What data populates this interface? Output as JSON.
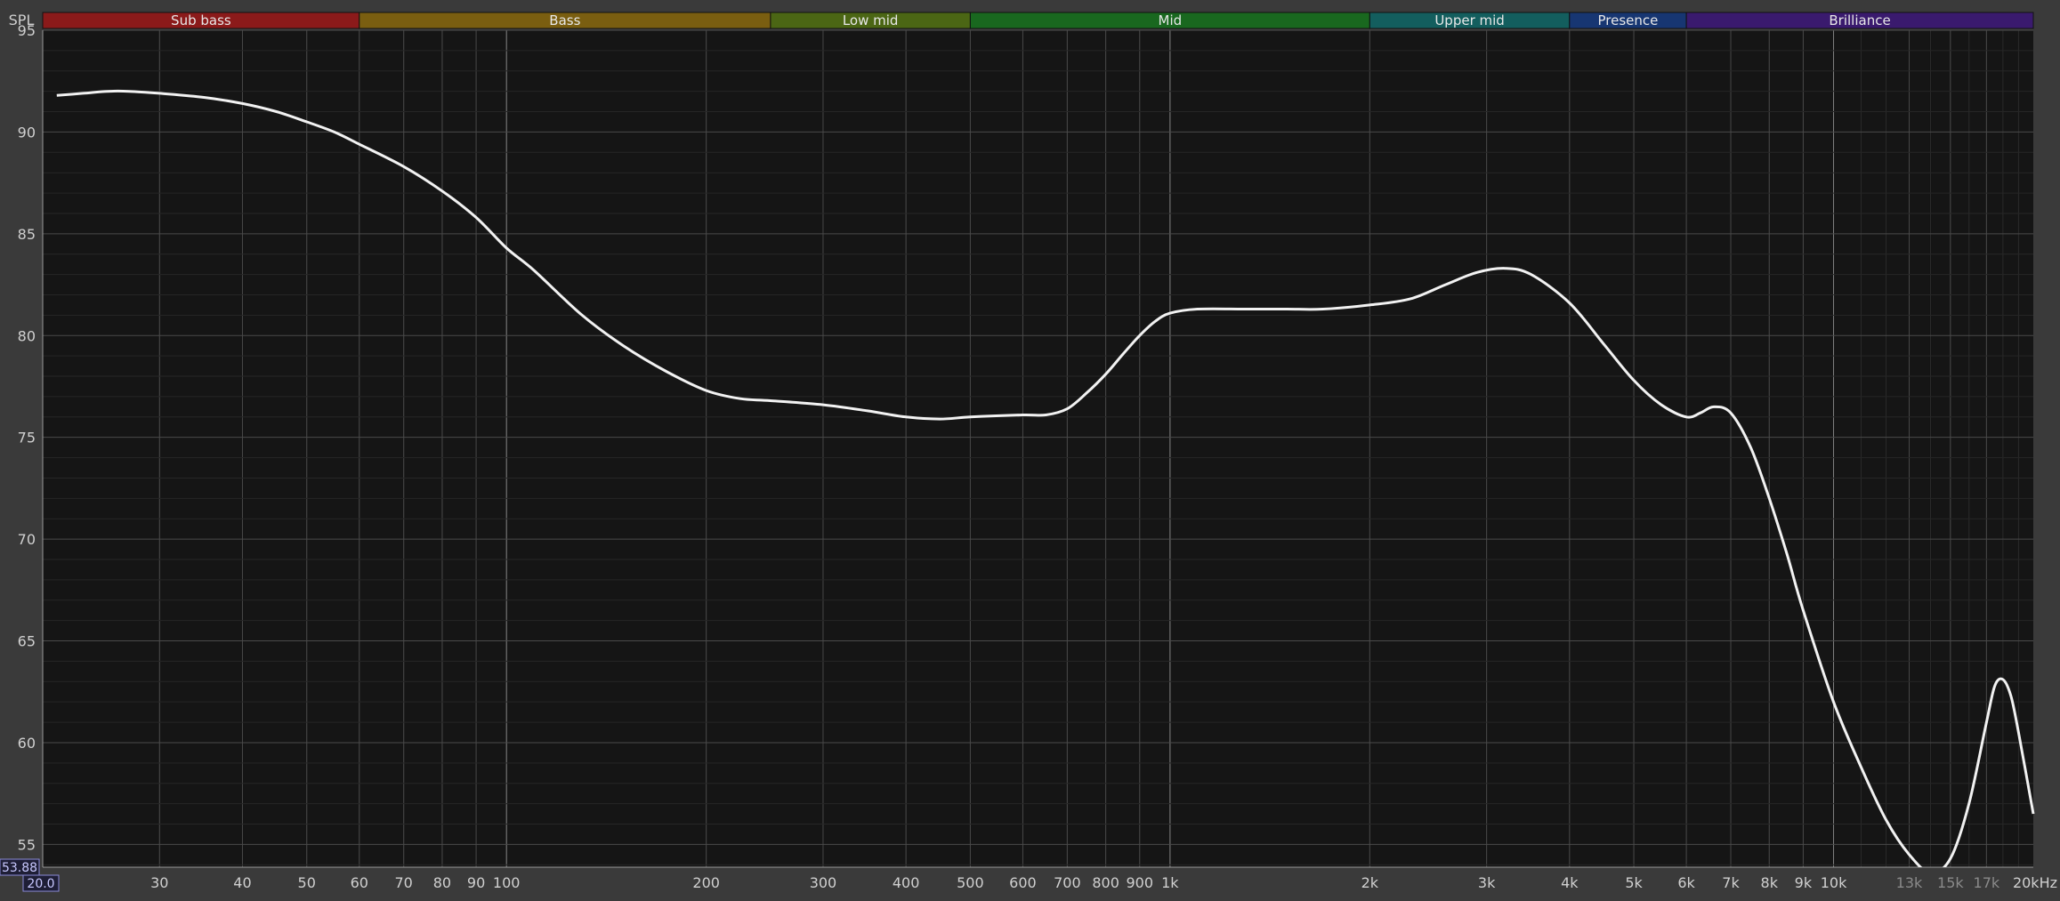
{
  "chart_data": {
    "type": "line",
    "ylabel": "SPL",
    "ylim": [
      53.88,
      95
    ],
    "xlim": [
      20,
      20000
    ],
    "x_scale": "log",
    "grid": true,
    "y_ticks": [
      95,
      90,
      85,
      80,
      75,
      70,
      65,
      60,
      55
    ],
    "x_ticks": [
      {
        "value": 30,
        "label": "30"
      },
      {
        "value": 40,
        "label": "40"
      },
      {
        "value": 50,
        "label": "50"
      },
      {
        "value": 60,
        "label": "60"
      },
      {
        "value": 70,
        "label": "70"
      },
      {
        "value": 80,
        "label": "80"
      },
      {
        "value": 90,
        "label": "90"
      },
      {
        "value": 100,
        "label": "100"
      },
      {
        "value": 200,
        "label": "200"
      },
      {
        "value": 300,
        "label": "300"
      },
      {
        "value": 400,
        "label": "400"
      },
      {
        "value": 500,
        "label": "500"
      },
      {
        "value": 600,
        "label": "600"
      },
      {
        "value": 700,
        "label": "700"
      },
      {
        "value": 800,
        "label": "800"
      },
      {
        "value": 900,
        "label": "900"
      },
      {
        "value": 1000,
        "label": "1k"
      },
      {
        "value": 2000,
        "label": "2k"
      },
      {
        "value": 3000,
        "label": "3k"
      },
      {
        "value": 4000,
        "label": "4k"
      },
      {
        "value": 5000,
        "label": "5k"
      },
      {
        "value": 6000,
        "label": "6k"
      },
      {
        "value": 7000,
        "label": "7k"
      },
      {
        "value": 8000,
        "label": "8k"
      },
      {
        "value": 9000,
        "label": "9k"
      },
      {
        "value": 10000,
        "label": "10k"
      },
      {
        "value": 13000,
        "label": "13k",
        "dim": true
      },
      {
        "value": 15000,
        "label": "15k",
        "dim": true
      },
      {
        "value": 17000,
        "label": "17k",
        "dim": true
      },
      {
        "value": 20000,
        "label": "20kHz"
      }
    ],
    "corner_readouts": {
      "y_min": "53.88",
      "x_min": "20.0"
    },
    "bands": [
      {
        "name": "Sub bass",
        "from": 20,
        "to": 60,
        "color": "#8b1a1a"
      },
      {
        "name": "Bass",
        "from": 60,
        "to": 250,
        "color": "#7a5e10"
      },
      {
        "name": "Low mid",
        "from": 250,
        "to": 500,
        "color": "#4b6614"
      },
      {
        "name": "Mid",
        "from": 500,
        "to": 2000,
        "color": "#19681f"
      },
      {
        "name": "Upper mid",
        "from": 2000,
        "to": 4000,
        "color": "#135e5e"
      },
      {
        "name": "Presence",
        "from": 4000,
        "to": 6000,
        "color": "#173672"
      },
      {
        "name": "Brilliance",
        "from": 6000,
        "to": 20000,
        "color": "#3a1a6e"
      }
    ],
    "series": [
      {
        "color": "#f2f2f2",
        "points": [
          [
            21,
            91.8
          ],
          [
            23,
            91.9
          ],
          [
            25,
            92.0
          ],
          [
            27,
            92.0
          ],
          [
            30,
            91.9
          ],
          [
            35,
            91.7
          ],
          [
            40,
            91.4
          ],
          [
            45,
            91.0
          ],
          [
            50,
            90.5
          ],
          [
            55,
            90.0
          ],
          [
            60,
            89.4
          ],
          [
            70,
            88.3
          ],
          [
            80,
            87.1
          ],
          [
            90,
            85.8
          ],
          [
            100,
            84.3
          ],
          [
            110,
            83.2
          ],
          [
            130,
            81.0
          ],
          [
            150,
            79.5
          ],
          [
            175,
            78.2
          ],
          [
            200,
            77.3
          ],
          [
            225,
            76.9
          ],
          [
            250,
            76.8
          ],
          [
            300,
            76.6
          ],
          [
            350,
            76.3
          ],
          [
            400,
            76.0
          ],
          [
            450,
            75.9
          ],
          [
            500,
            76.0
          ],
          [
            600,
            76.1
          ],
          [
            650,
            76.1
          ],
          [
            700,
            76.4
          ],
          [
            750,
            77.2
          ],
          [
            800,
            78.1
          ],
          [
            850,
            79.1
          ],
          [
            900,
            80.0
          ],
          [
            950,
            80.7
          ],
          [
            1000,
            81.1
          ],
          [
            1100,
            81.3
          ],
          [
            1300,
            81.3
          ],
          [
            1500,
            81.3
          ],
          [
            1700,
            81.3
          ],
          [
            2000,
            81.5
          ],
          [
            2300,
            81.8
          ],
          [
            2600,
            82.5
          ],
          [
            2900,
            83.1
          ],
          [
            3200,
            83.3
          ],
          [
            3500,
            83.0
          ],
          [
            4000,
            81.6
          ],
          [
            4500,
            79.6
          ],
          [
            5000,
            77.8
          ],
          [
            5500,
            76.6
          ],
          [
            6000,
            76.0
          ],
          [
            6300,
            76.2
          ],
          [
            6600,
            76.5
          ],
          [
            7000,
            76.2
          ],
          [
            7500,
            74.5
          ],
          [
            8000,
            72.0
          ],
          [
            8500,
            69.3
          ],
          [
            9000,
            66.5
          ],
          [
            10000,
            62.0
          ],
          [
            11000,
            58.8
          ],
          [
            12000,
            56.2
          ],
          [
            13000,
            54.5
          ],
          [
            14000,
            53.6
          ],
          [
            15000,
            54.3
          ],
          [
            16000,
            57.0
          ],
          [
            17000,
            61.0
          ],
          [
            17500,
            62.8
          ],
          [
            18000,
            63.1
          ],
          [
            18500,
            62.3
          ],
          [
            19000,
            60.5
          ],
          [
            20000,
            56.5
          ]
        ]
      }
    ]
  }
}
